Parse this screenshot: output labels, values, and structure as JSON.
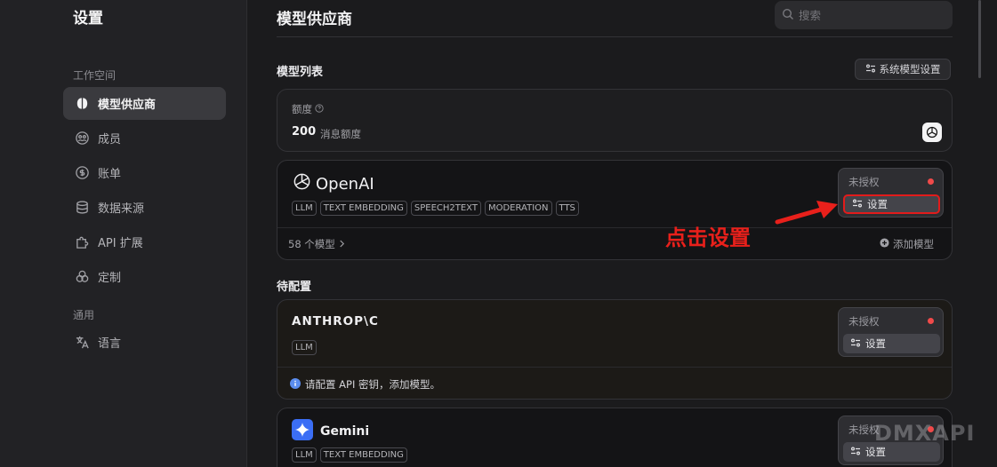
{
  "sidebar": {
    "title": "设置",
    "group_workspace": "工作空间",
    "group_general": "通用",
    "items": [
      {
        "label": "模型供应商",
        "icon": "brain-icon"
      },
      {
        "label": "成员",
        "icon": "members-icon"
      },
      {
        "label": "账单",
        "icon": "billing-icon"
      },
      {
        "label": "数据来源",
        "icon": "database-icon"
      },
      {
        "label": "API 扩展",
        "icon": "puzzle-icon"
      },
      {
        "label": "定制",
        "icon": "customize-icon"
      },
      {
        "label": "语言",
        "icon": "translate-icon"
      }
    ]
  },
  "main": {
    "title": "模型供应商",
    "search_placeholder": "搜索",
    "model_list_title": "模型列表",
    "system_settings_label": "系统模型设置",
    "pending_title": "待配置"
  },
  "quota": {
    "label": "额度",
    "value": "200",
    "unit": "消息额度"
  },
  "providers": [
    {
      "name": "OpenAI",
      "tags": [
        "LLM",
        "TEXT EMBEDDING",
        "SPEECH2TEXT",
        "MODERATION",
        "TTS"
      ],
      "status": "未授权",
      "config_label": "设置",
      "model_count": "58 个模型",
      "add_model_label": "添加模型"
    },
    {
      "name": "ANTHROP\\C",
      "tags": [
        "LLM"
      ],
      "status": "未授权",
      "config_label": "设置",
      "note": "请配置 API 密钥，添加模型。"
    },
    {
      "name": "Gemini",
      "tags": [
        "LLM",
        "TEXT EMBEDDING"
      ],
      "status": "未授权",
      "config_label": "设置"
    }
  ],
  "annotation": "点击设置",
  "watermark": "DMXAPI",
  "colors": {
    "background": "#1b1b1d",
    "sidebar": "#222225",
    "status_red": "#f04a4a",
    "annotation_red": "#e8201b"
  }
}
